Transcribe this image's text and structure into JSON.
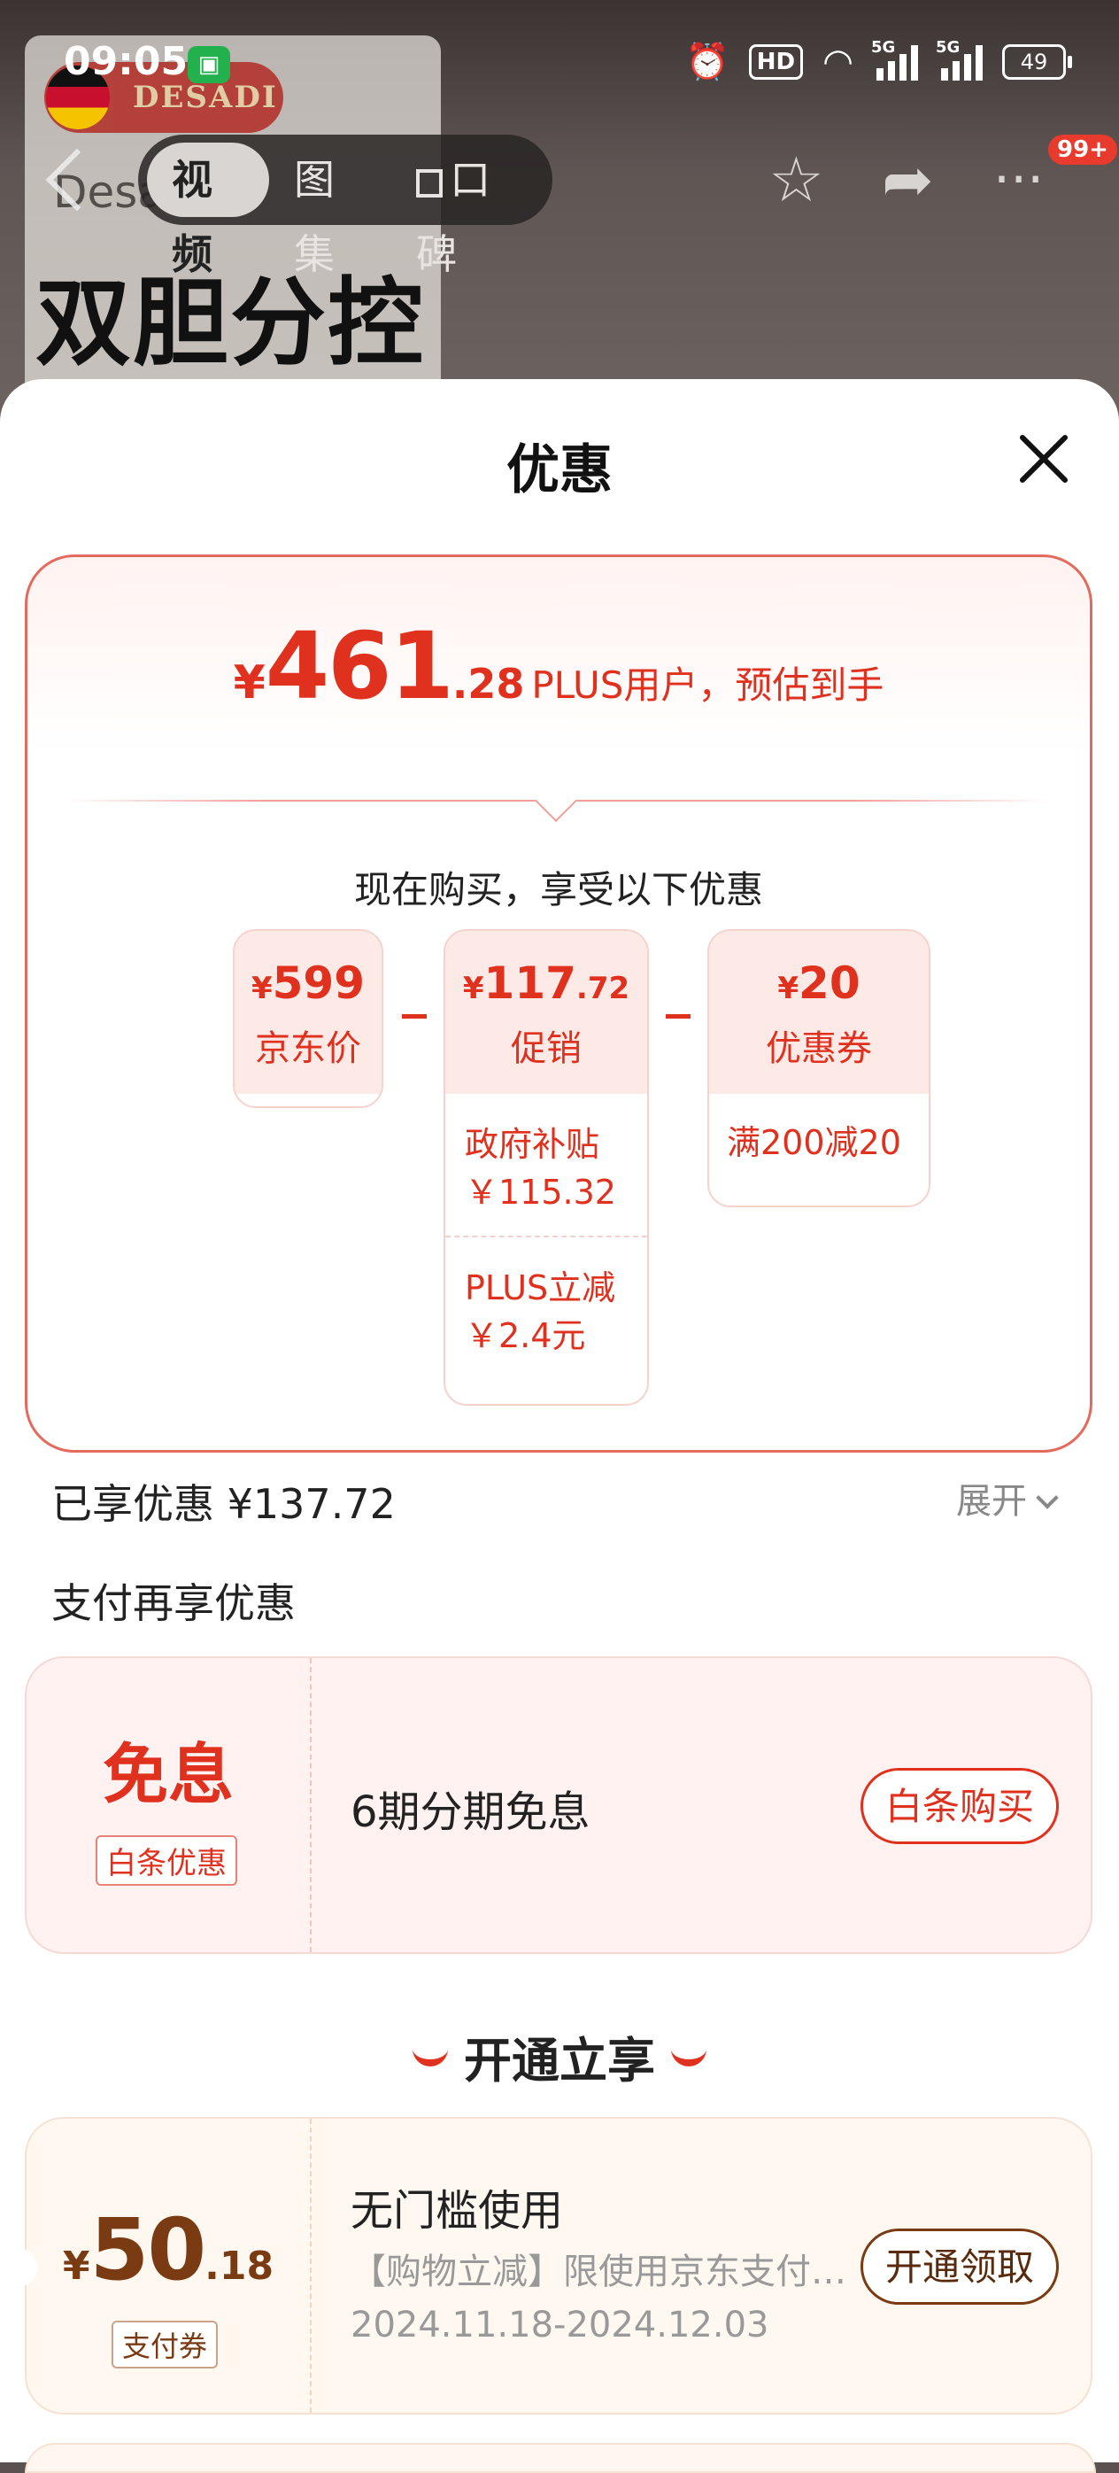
{
  "status_bar": {
    "time": "09:05",
    "hd_label": "HD",
    "signal1_label": "5G",
    "signal2_label": "5G",
    "battery": "49"
  },
  "background": {
    "brand": "DESADI",
    "sub": "Desa",
    "headline": "双胆分控"
  },
  "top_nav": {
    "tabs": [
      "视频",
      "图集",
      "口碑"
    ],
    "active_tab": "视频",
    "badge": "99+"
  },
  "sheet": {
    "title": "优惠",
    "estimate": {
      "currency": "¥",
      "integer": "461",
      "decimal": ".28",
      "label": "PLUS用户，预估到手"
    },
    "now_text": "现在购买，享受以下优惠",
    "breakdown": {
      "jd_price": {
        "currency": "¥",
        "amount": "599",
        "label": "京东价"
      },
      "promotion": {
        "currency": "¥",
        "amount": "117",
        "decimal": ".72",
        "label": "促销",
        "items": [
          {
            "name": "政府补贴",
            "value": "￥115.32"
          },
          {
            "name": "PLUS立减",
            "value": "￥2.4元"
          }
        ]
      },
      "coupon": {
        "currency": "¥",
        "amount": "20",
        "label": "优惠券",
        "items": [
          {
            "name": "满200减20"
          }
        ]
      }
    },
    "enjoyed": "已享优惠 ¥137.72",
    "expand_label": "展开",
    "pay_more_title": "支付再享优惠",
    "baitiao": {
      "headline": "免息",
      "tag": "白条优惠",
      "desc": "6期分期免息",
      "button": "白条购买"
    },
    "open_title": "开通立享",
    "coupon_card": {
      "currency": "¥",
      "integer": "50",
      "decimal": ".18",
      "tag": "支付券",
      "title": "无门槛使用",
      "subtitle": "【购物立减】限使用京东支付…",
      "dates": "2024.11.18-2024.12.03",
      "button": "开通领取"
    }
  },
  "colors": {
    "accent_red": "#e0301e",
    "brown": "#7a3a12",
    "card_border": "#e46a5e"
  }
}
